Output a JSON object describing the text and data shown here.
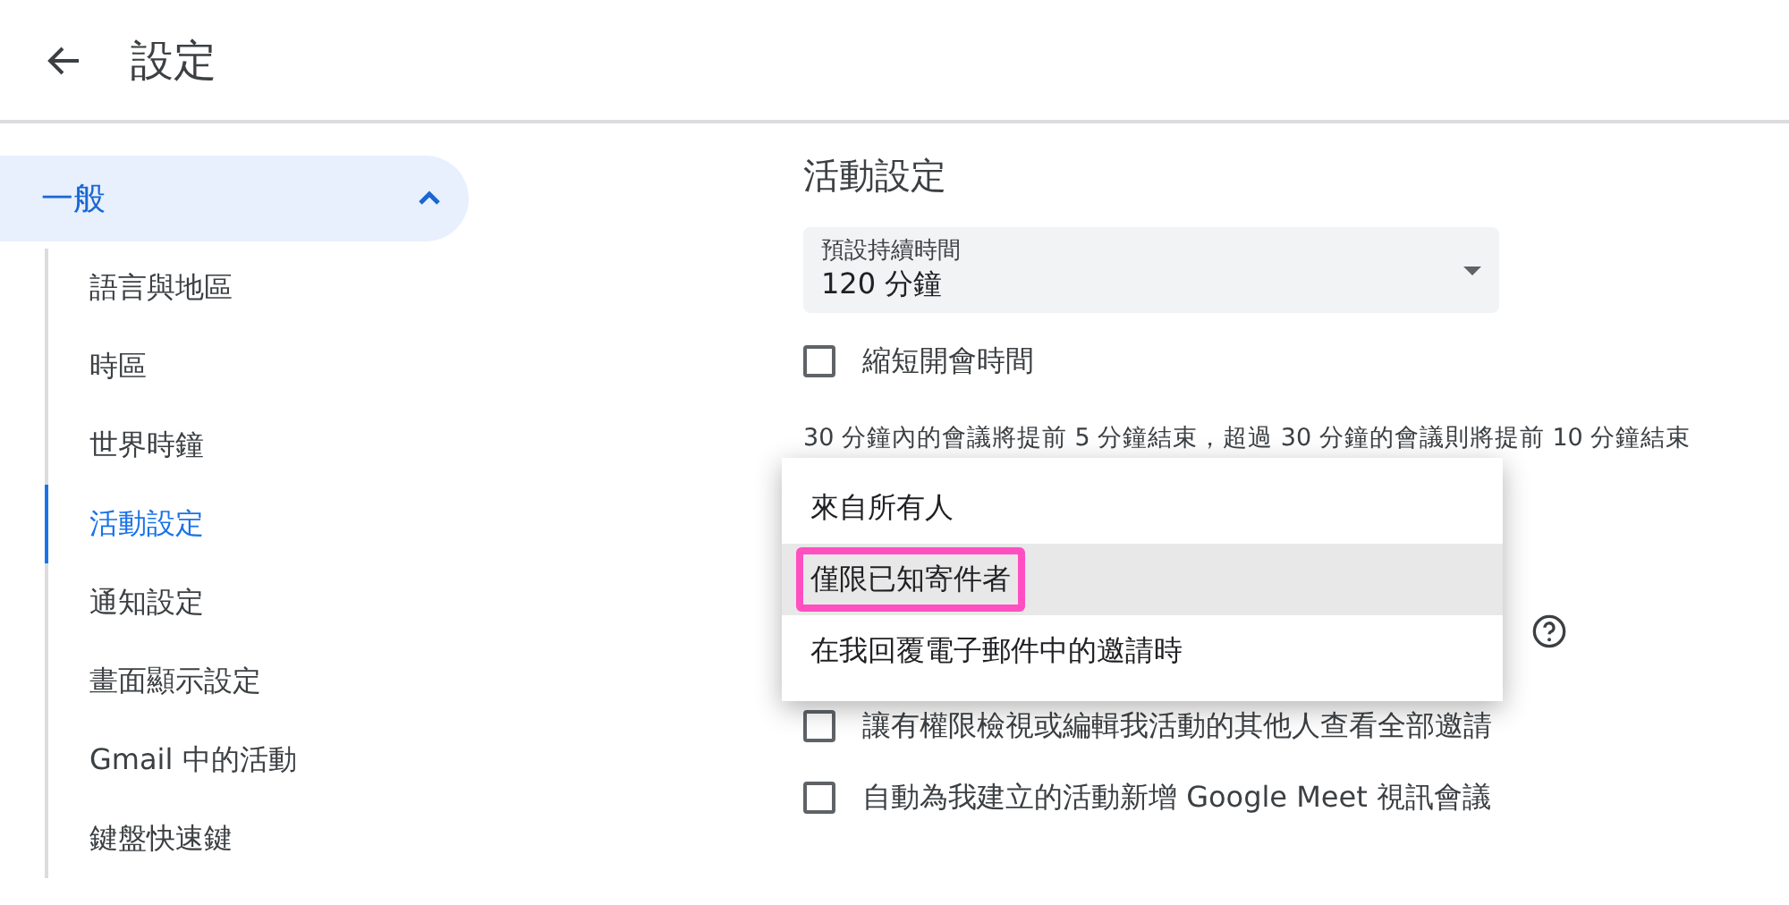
{
  "header": {
    "title": "設定"
  },
  "sidebar": {
    "section": {
      "label": "一般",
      "expanded": true
    },
    "items": [
      {
        "label": "語言與地區",
        "selected": false
      },
      {
        "label": "時區",
        "selected": false
      },
      {
        "label": "世界時鐘",
        "selected": false
      },
      {
        "label": "活動設定",
        "selected": true
      },
      {
        "label": "通知設定",
        "selected": false
      },
      {
        "label": "畫面顯示設定",
        "selected": false
      },
      {
        "label": "Gmail 中的活動",
        "selected": false
      },
      {
        "label": "鍵盤快速鍵",
        "selected": false
      }
    ]
  },
  "main": {
    "title": "活動設定",
    "duration": {
      "label": "預設持續時間",
      "value": "120 分鐘"
    },
    "shorten": {
      "label": "縮短開會時間",
      "checked": false
    },
    "note": "30 分鐘內的會議將提前 5 分鐘結束，超過 30 分鐘的會議則將提前 10 分鐘結束",
    "menu": [
      {
        "label": "來自所有人",
        "selected": false,
        "highlighted": false
      },
      {
        "label": "僅限已知寄件者",
        "selected": true,
        "highlighted": true
      },
      {
        "label": "在我回覆電子郵件中的邀請時",
        "selected": false,
        "highlighted": false
      }
    ],
    "checkboxes": [
      {
        "label": "讓有權限檢視或編輯我活動的其他人查看全部邀請",
        "checked": false
      },
      {
        "label": "自動為我建立的活動新增 Google Meet 視訊會議",
        "checked": false
      }
    ]
  }
}
